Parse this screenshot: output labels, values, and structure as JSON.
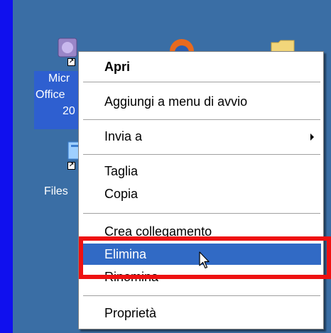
{
  "desktop": {
    "icons": [
      {
        "name": "microsoft-office-icon",
        "label_lines": [
          "Micr",
          "Office",
          "20"
        ]
      },
      {
        "name": "firefox-icon"
      },
      {
        "name": "folder-icon"
      },
      {
        "name": "files-icon",
        "label_lines": [
          "Files"
        ]
      }
    ]
  },
  "context_menu": {
    "items": {
      "open": "Apri",
      "add_start_menu": "Aggiungi a menu di avvio",
      "send_to": "Invia a",
      "cut": "Taglia",
      "copy": "Copia",
      "create_shortcut": "Crea collegamento",
      "delete": "Elimina",
      "rename": "Rinomina",
      "properties": "Proprietà"
    },
    "highlighted_item": "delete"
  },
  "colors": {
    "page_border": "#1010ee",
    "desktop": "#3a6ea5",
    "highlight": "#316ac5",
    "annotation_box": "#ee1111"
  },
  "cursor": "arrow-pointer-icon"
}
